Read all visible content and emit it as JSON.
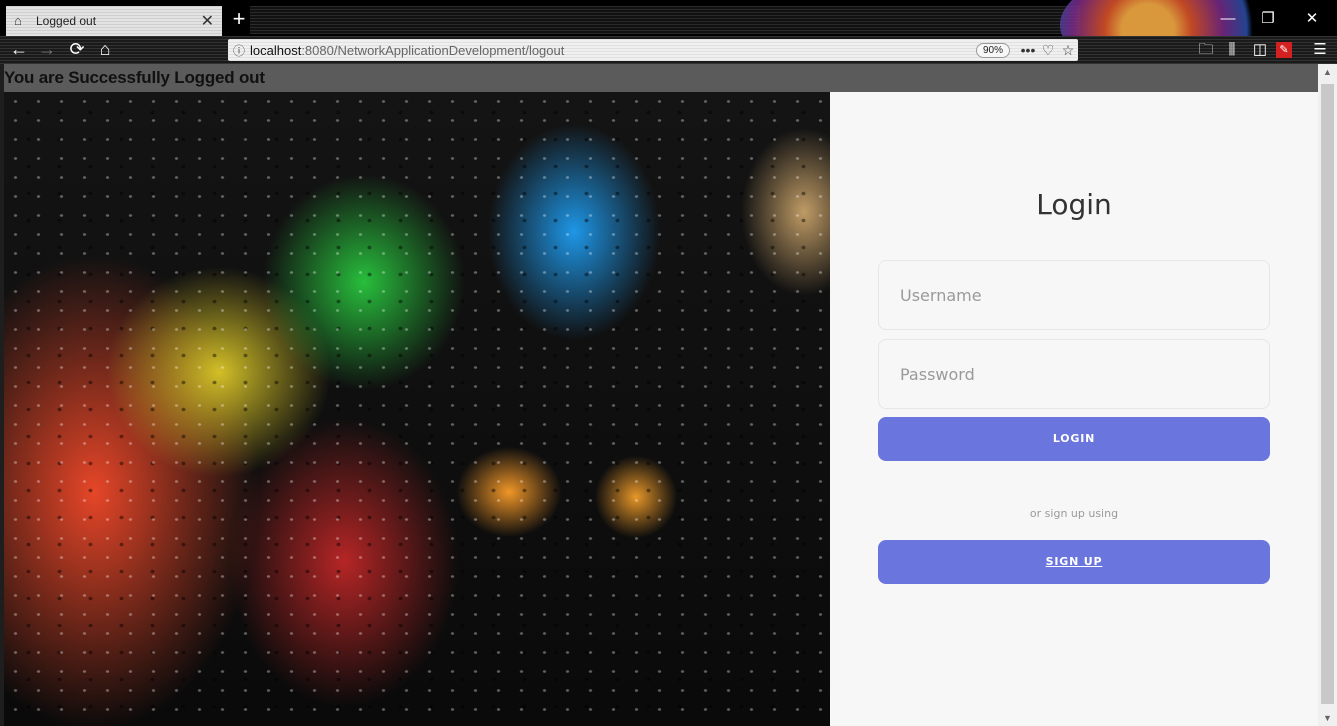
{
  "browser": {
    "tab_title": "Logged out",
    "tab_icon": "home-icon",
    "tab_close": "✕",
    "new_tab": "+",
    "url_host": "localhost",
    "url_path": ":8080/NetworkApplicationDevelopment/logout",
    "zoom": "90%",
    "icons": {
      "back": "←",
      "forward": "→",
      "reload": "⟳",
      "home": "⌂",
      "info": "ⓘ",
      "more": "•••",
      "pocket": "♡",
      "bookmark": "☆",
      "downloads": "🗀",
      "library": "⫼",
      "sidebar": "◫",
      "extension": "✎",
      "menu": "☰",
      "minimize": "—",
      "restore": "❐",
      "close": "✕"
    }
  },
  "page": {
    "message": "You are Successfully Logged out",
    "login": {
      "title": "Login",
      "username_placeholder": "Username",
      "password_placeholder": "Password",
      "login_label": "LOGIN",
      "or_text": "or sign up using",
      "signup_label": "SIGN UP"
    }
  },
  "colors": {
    "accent": "#6a75de",
    "message_bar": "#5b5b5b",
    "panel_bg": "#f7f7f7"
  }
}
